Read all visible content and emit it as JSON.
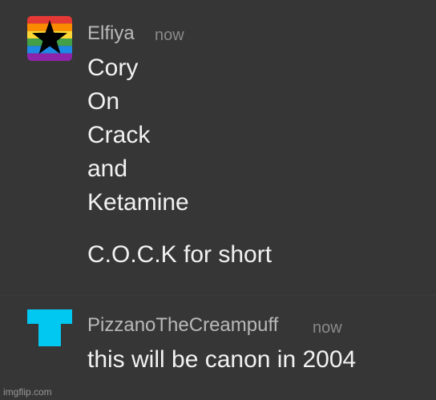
{
  "messages": [
    {
      "author": "Elfiya",
      "timestamp": "now",
      "avatar_icon": "rainbow-star-avatar-icon",
      "lines": [
        "Cory",
        "On",
        "Crack",
        "and",
        "Ketamine",
        "C.O.C.K for short"
      ]
    },
    {
      "author": "PizzanoTheCreampuff",
      "timestamp": "now",
      "avatar_icon": "cyan-t-shape-avatar-icon",
      "lines": [
        "this will be canon in 2004"
      ]
    }
  ],
  "colors": {
    "background": "#363636",
    "author_text": "#b9b9b9",
    "timestamp_text": "#8a8a8a",
    "message_text": "#f2f2f2",
    "avatar2_cyan": "#00c8f0",
    "rainbow": [
      "#e53935",
      "#fb8c00",
      "#fdd835",
      "#43a047",
      "#1e88e5",
      "#8e24aa"
    ]
  },
  "watermark": "imgflip.com"
}
